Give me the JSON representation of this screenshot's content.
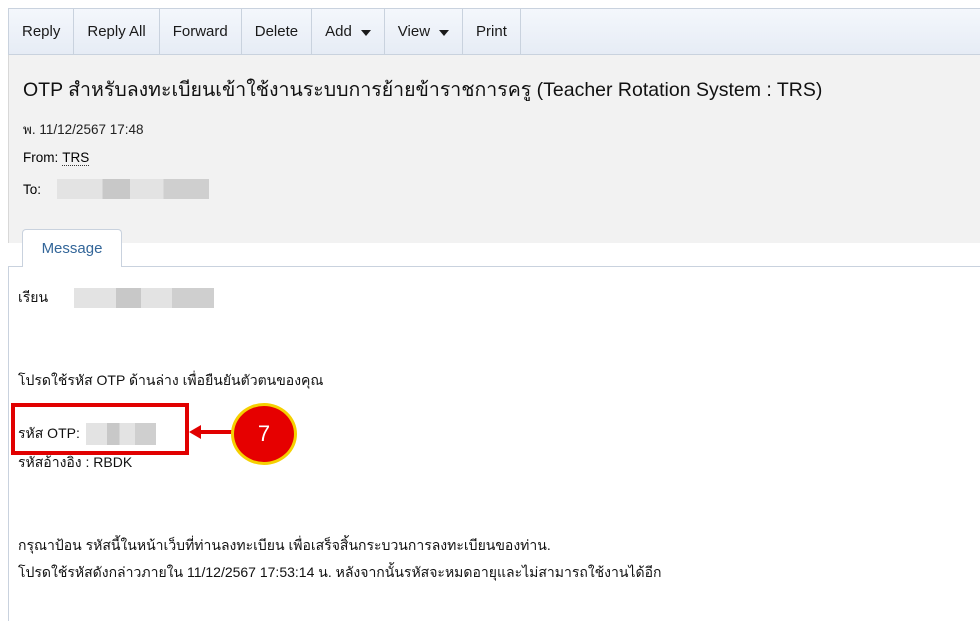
{
  "toolbar": {
    "reply": "Reply",
    "reply_all": "Reply All",
    "forward": "Forward",
    "delete": "Delete",
    "add": "Add",
    "view": "View",
    "print": "Print"
  },
  "header": {
    "subject": "OTP สำหรับลงทะเบียนเข้าใช้งานระบบการย้ายข้าราชการครู (Teacher Rotation System : TRS)",
    "date": "พ. 11/12/2567 17:48",
    "from_label": "From:",
    "from_name": "TRS",
    "to_label": "To:"
  },
  "tabs": {
    "message": "Message"
  },
  "body": {
    "greeting": "เรียน",
    "instruction": "โปรดใช้รหัส OTP ด้านล่าง เพื่อยืนยันตัวตนของคุณ",
    "otp_label": "รหัส OTP:",
    "ref_code": "รหัสอ้างอิง : RBDK",
    "line1": "กรุณาป้อน รหัสนี้ในหน้าเว็บที่ท่านลงทะเบียน เพื่อเสร็จสิ้นกระบวนการลงทะเบียนของท่าน.",
    "line2": "โปรดใช้รหัสดังกล่าวภายใน 11/12/2567 17:53:14 น. หลังจากนั้นรหัสจะหมดอายุและไม่สามารถใช้งานได้อีก"
  },
  "annotation": {
    "step_number": "7",
    "color": "#e10000",
    "badge_border": "#f5d000"
  }
}
